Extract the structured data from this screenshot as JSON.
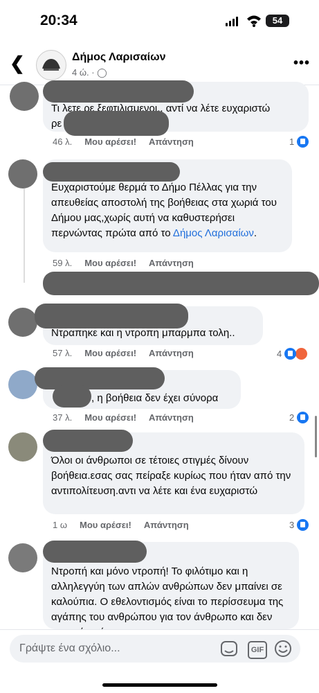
{
  "status": {
    "time": "20:34",
    "battery": "54"
  },
  "header": {
    "page_name": "Δήμος Λαρισαίων",
    "time": "4 ώ. · "
  },
  "comments": [
    {
      "text1": "Τι λετε ρε ξεφτιλισμενοι.. αντί να λέτε ευχαριστώ",
      "text2": "ρε",
      "time": "46 λ.",
      "like": "Μου αρέσει!",
      "reply": "Απάντηση",
      "count": "1"
    },
    {
      "text": "Ευχαριστούμε θερμά το Δήμο Πέλλας για την απευθείας αποστολή της βοήθειας στα χωριά του Δήμου μας,χωρίς αυτή να καθυστερήσει περνώντας πρώτα  από το ",
      "mention": "Δήμος Λαρισαίων",
      "tail": ".",
      "time": "59 λ.",
      "like": "Μου αρέσει!",
      "reply": "Απάντηση"
    },
    {
      "text": "Ντραπηκε και η ντροπη μπαρμπα τολη..",
      "time": "57 λ.",
      "like": "Μου αρέσει!",
      "reply": "Απάντηση",
      "count": "4"
    },
    {
      "text": ", η βοήθεια δεν έχει σύνορα",
      "time": "37 λ.",
      "like": "Μου αρέσει!",
      "reply": "Απάντηση",
      "count": "2"
    },
    {
      "text": "Όλοι οι άνθρωποι σε τέτοιες στιγμές  δίνουν βοήθεια.εσας σας πείραξε κυρίως που ήταν από την αντιπολίτευση.αντι να λέτε και ένα ευχαριστώ",
      "time": "1 ω",
      "like": "Μου αρέσει!",
      "reply": "Απάντηση",
      "count": "3"
    },
    {
      "text": "Ντροπή και μόνο ντροπή! Το φιλότιμο και η αλληλεγγύη των απλών ανθρώπων δεν μπαίνει σε καλούπια. Ο εθελοντισμός είναι το περίσσευμα της αγάπης του ανθρώπου για τον άνθρωπο και δεν μπορεί να έχει"
    }
  ],
  "composer": {
    "placeholder": "Γράψτε ένα σχόλιο...",
    "gif": "GIF"
  }
}
